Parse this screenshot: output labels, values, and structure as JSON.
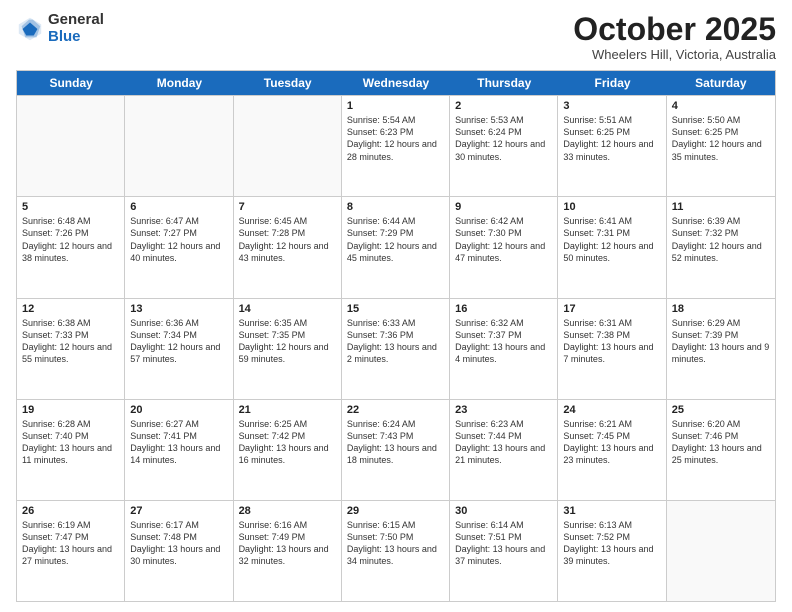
{
  "logo": {
    "general": "General",
    "blue": "Blue"
  },
  "header": {
    "month": "October 2025",
    "location": "Wheelers Hill, Victoria, Australia"
  },
  "weekdays": [
    "Sunday",
    "Monday",
    "Tuesday",
    "Wednesday",
    "Thursday",
    "Friday",
    "Saturday"
  ],
  "rows": [
    [
      {
        "day": "",
        "sunrise": "",
        "sunset": "",
        "daylight": ""
      },
      {
        "day": "",
        "sunrise": "",
        "sunset": "",
        "daylight": ""
      },
      {
        "day": "",
        "sunrise": "",
        "sunset": "",
        "daylight": ""
      },
      {
        "day": "1",
        "sunrise": "Sunrise: 5:54 AM",
        "sunset": "Sunset: 6:23 PM",
        "daylight": "Daylight: 12 hours and 28 minutes."
      },
      {
        "day": "2",
        "sunrise": "Sunrise: 5:53 AM",
        "sunset": "Sunset: 6:24 PM",
        "daylight": "Daylight: 12 hours and 30 minutes."
      },
      {
        "day": "3",
        "sunrise": "Sunrise: 5:51 AM",
        "sunset": "Sunset: 6:25 PM",
        "daylight": "Daylight: 12 hours and 33 minutes."
      },
      {
        "day": "4",
        "sunrise": "Sunrise: 5:50 AM",
        "sunset": "Sunset: 6:25 PM",
        "daylight": "Daylight: 12 hours and 35 minutes."
      }
    ],
    [
      {
        "day": "5",
        "sunrise": "Sunrise: 6:48 AM",
        "sunset": "Sunset: 7:26 PM",
        "daylight": "Daylight: 12 hours and 38 minutes."
      },
      {
        "day": "6",
        "sunrise": "Sunrise: 6:47 AM",
        "sunset": "Sunset: 7:27 PM",
        "daylight": "Daylight: 12 hours and 40 minutes."
      },
      {
        "day": "7",
        "sunrise": "Sunrise: 6:45 AM",
        "sunset": "Sunset: 7:28 PM",
        "daylight": "Daylight: 12 hours and 43 minutes."
      },
      {
        "day": "8",
        "sunrise": "Sunrise: 6:44 AM",
        "sunset": "Sunset: 7:29 PM",
        "daylight": "Daylight: 12 hours and 45 minutes."
      },
      {
        "day": "9",
        "sunrise": "Sunrise: 6:42 AM",
        "sunset": "Sunset: 7:30 PM",
        "daylight": "Daylight: 12 hours and 47 minutes."
      },
      {
        "day": "10",
        "sunrise": "Sunrise: 6:41 AM",
        "sunset": "Sunset: 7:31 PM",
        "daylight": "Daylight: 12 hours and 50 minutes."
      },
      {
        "day": "11",
        "sunrise": "Sunrise: 6:39 AM",
        "sunset": "Sunset: 7:32 PM",
        "daylight": "Daylight: 12 hours and 52 minutes."
      }
    ],
    [
      {
        "day": "12",
        "sunrise": "Sunrise: 6:38 AM",
        "sunset": "Sunset: 7:33 PM",
        "daylight": "Daylight: 12 hours and 55 minutes."
      },
      {
        "day": "13",
        "sunrise": "Sunrise: 6:36 AM",
        "sunset": "Sunset: 7:34 PM",
        "daylight": "Daylight: 12 hours and 57 minutes."
      },
      {
        "day": "14",
        "sunrise": "Sunrise: 6:35 AM",
        "sunset": "Sunset: 7:35 PM",
        "daylight": "Daylight: 12 hours and 59 minutes."
      },
      {
        "day": "15",
        "sunrise": "Sunrise: 6:33 AM",
        "sunset": "Sunset: 7:36 PM",
        "daylight": "Daylight: 13 hours and 2 minutes."
      },
      {
        "day": "16",
        "sunrise": "Sunrise: 6:32 AM",
        "sunset": "Sunset: 7:37 PM",
        "daylight": "Daylight: 13 hours and 4 minutes."
      },
      {
        "day": "17",
        "sunrise": "Sunrise: 6:31 AM",
        "sunset": "Sunset: 7:38 PM",
        "daylight": "Daylight: 13 hours and 7 minutes."
      },
      {
        "day": "18",
        "sunrise": "Sunrise: 6:29 AM",
        "sunset": "Sunset: 7:39 PM",
        "daylight": "Daylight: 13 hours and 9 minutes."
      }
    ],
    [
      {
        "day": "19",
        "sunrise": "Sunrise: 6:28 AM",
        "sunset": "Sunset: 7:40 PM",
        "daylight": "Daylight: 13 hours and 11 minutes."
      },
      {
        "day": "20",
        "sunrise": "Sunrise: 6:27 AM",
        "sunset": "Sunset: 7:41 PM",
        "daylight": "Daylight: 13 hours and 14 minutes."
      },
      {
        "day": "21",
        "sunrise": "Sunrise: 6:25 AM",
        "sunset": "Sunset: 7:42 PM",
        "daylight": "Daylight: 13 hours and 16 minutes."
      },
      {
        "day": "22",
        "sunrise": "Sunrise: 6:24 AM",
        "sunset": "Sunset: 7:43 PM",
        "daylight": "Daylight: 13 hours and 18 minutes."
      },
      {
        "day": "23",
        "sunrise": "Sunrise: 6:23 AM",
        "sunset": "Sunset: 7:44 PM",
        "daylight": "Daylight: 13 hours and 21 minutes."
      },
      {
        "day": "24",
        "sunrise": "Sunrise: 6:21 AM",
        "sunset": "Sunset: 7:45 PM",
        "daylight": "Daylight: 13 hours and 23 minutes."
      },
      {
        "day": "25",
        "sunrise": "Sunrise: 6:20 AM",
        "sunset": "Sunset: 7:46 PM",
        "daylight": "Daylight: 13 hours and 25 minutes."
      }
    ],
    [
      {
        "day": "26",
        "sunrise": "Sunrise: 6:19 AM",
        "sunset": "Sunset: 7:47 PM",
        "daylight": "Daylight: 13 hours and 27 minutes."
      },
      {
        "day": "27",
        "sunrise": "Sunrise: 6:17 AM",
        "sunset": "Sunset: 7:48 PM",
        "daylight": "Daylight: 13 hours and 30 minutes."
      },
      {
        "day": "28",
        "sunrise": "Sunrise: 6:16 AM",
        "sunset": "Sunset: 7:49 PM",
        "daylight": "Daylight: 13 hours and 32 minutes."
      },
      {
        "day": "29",
        "sunrise": "Sunrise: 6:15 AM",
        "sunset": "Sunset: 7:50 PM",
        "daylight": "Daylight: 13 hours and 34 minutes."
      },
      {
        "day": "30",
        "sunrise": "Sunrise: 6:14 AM",
        "sunset": "Sunset: 7:51 PM",
        "daylight": "Daylight: 13 hours and 37 minutes."
      },
      {
        "day": "31",
        "sunrise": "Sunrise: 6:13 AM",
        "sunset": "Sunset: 7:52 PM",
        "daylight": "Daylight: 13 hours and 39 minutes."
      },
      {
        "day": "",
        "sunrise": "",
        "sunset": "",
        "daylight": ""
      }
    ]
  ]
}
